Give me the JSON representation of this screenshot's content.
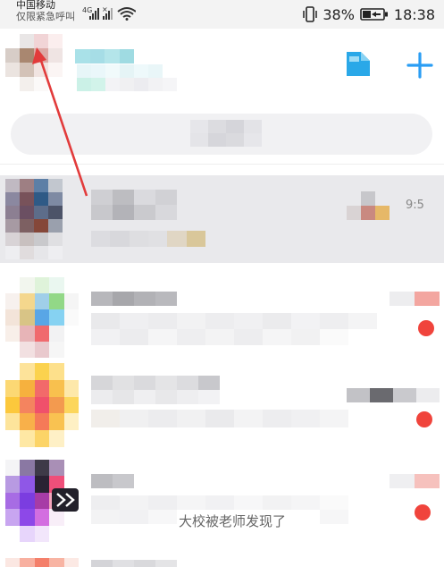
{
  "status_bar": {
    "carrier_line1": "中国移动",
    "carrier_line2": "仅限紧急呼叫",
    "network": "4G",
    "battery_percent": "38%",
    "time": "18:38"
  },
  "conversations": [
    {
      "preview_visible": ""
    },
    {
      "preview_visible": ""
    },
    {
      "preview_visible": ""
    },
    {
      "preview_visible": "大校被老师发现了"
    }
  ],
  "pinned_time_partial": "9:5",
  "colors": {
    "accent_plus": "#2a9df4",
    "badge": "#f0443c",
    "annotation_arrow": "#e23b3b",
    "pinned_row_bg": "#e9e9ec"
  }
}
